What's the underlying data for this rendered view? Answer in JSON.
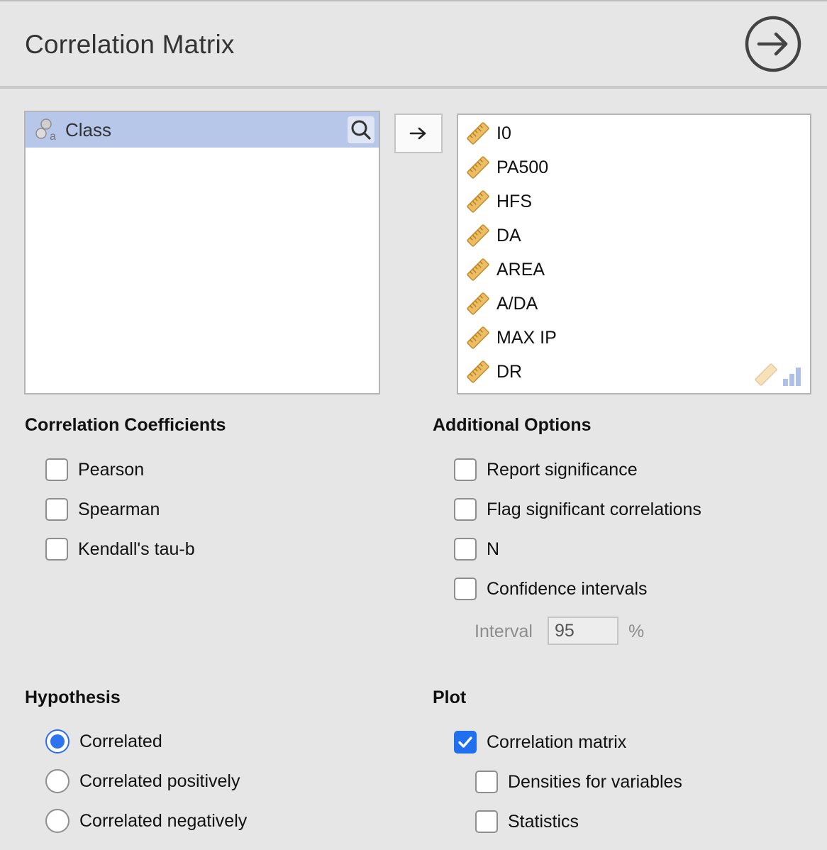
{
  "header": {
    "title": "Correlation Matrix"
  },
  "available": {
    "items": [
      {
        "label": "Class"
      }
    ]
  },
  "selected": {
    "items": [
      {
        "label": "I0"
      },
      {
        "label": "PA500"
      },
      {
        "label": "HFS"
      },
      {
        "label": "DA"
      },
      {
        "label": "AREA"
      },
      {
        "label": "A/DA"
      },
      {
        "label": "MAX IP"
      },
      {
        "label": "DR"
      }
    ]
  },
  "coefficients": {
    "title": "Correlation Coefficients",
    "options": [
      {
        "label": "Pearson",
        "checked": false
      },
      {
        "label": "Spearman",
        "checked": false
      },
      {
        "label": "Kendall's tau-b",
        "checked": false
      }
    ]
  },
  "additional": {
    "title": "Additional Options",
    "options": [
      {
        "label": "Report significance",
        "checked": false
      },
      {
        "label": "Flag significant correlations",
        "checked": false
      },
      {
        "label": "N",
        "checked": false
      },
      {
        "label": "Confidence intervals",
        "checked": false
      }
    ],
    "interval_label": "Interval",
    "interval_value": "95",
    "interval_unit": "%"
  },
  "hypothesis": {
    "title": "Hypothesis",
    "options": [
      {
        "label": "Correlated",
        "selected": true
      },
      {
        "label": "Correlated positively",
        "selected": false
      },
      {
        "label": "Correlated negatively",
        "selected": false
      }
    ]
  },
  "plot": {
    "title": "Plot",
    "options": [
      {
        "label": "Correlation matrix",
        "checked": true
      },
      {
        "label": "Densities for variables",
        "checked": false
      },
      {
        "label": "Statistics",
        "checked": false
      }
    ]
  },
  "colors": {
    "accent": "#1f6fef",
    "selection": "#b7c7ea",
    "ruler": "#e8b65a"
  },
  "icons": {
    "run": "arrow-circle-right-icon",
    "move": "arrow-right-icon",
    "search": "search-icon",
    "nominal": "nominal-icon",
    "continuous": "ruler-icon"
  }
}
